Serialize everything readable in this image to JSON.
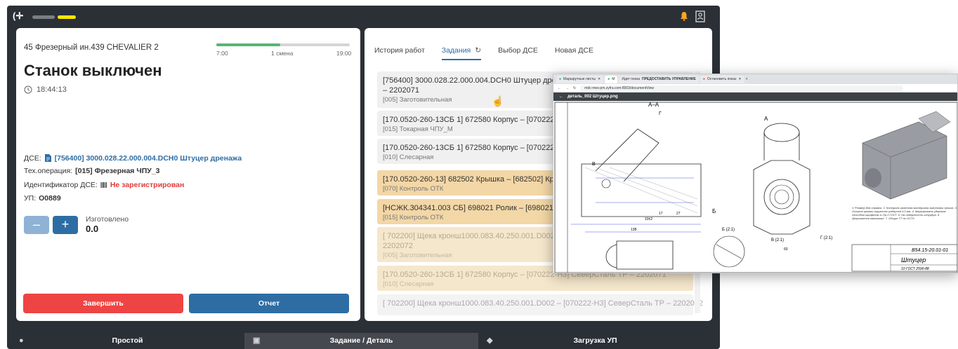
{
  "topbar": {
    "logo": "(✛",
    "bell_color": "#f5a623"
  },
  "machine": {
    "name": "45 Фрезерный ин.439 CHEVALIER 2",
    "shift_start": "7:00",
    "shift_name": "1 смена",
    "shift_end": "19:00",
    "shift_progress": 0.48,
    "status": "Станок выключен",
    "time": "18:44:13"
  },
  "details": {
    "dse_label": "ДСЕ:",
    "dse_value": "[756400] 3000.028.22.000.004.DCH0 Штуцер дренажа",
    "op_label": "Тех.операция:",
    "op_value": "[015] Фрезерная ЧПУ_3",
    "id_label": "Идентификатор ДСЕ:",
    "id_value": "Не зарегистрирован",
    "up_label": "УП:",
    "up_value": "O0889"
  },
  "counter": {
    "minus": "–",
    "plus": "+",
    "label": "Изготовлено",
    "value": "0.0"
  },
  "actions": {
    "finish": "Завершить",
    "report": "Отчет"
  },
  "tabs": [
    {
      "label": "История работ"
    },
    {
      "label": "Задания"
    },
    {
      "label": "Выбор ДСЕ"
    },
    {
      "label": "Новая ДСЕ"
    }
  ],
  "tasks": [
    {
      "title": "[756400] 3000.028.22.000.004.DCH0 Штуцер дренажа – [070222-Н3] СеверСталь ТР – 2202071",
      "op": "[005] Заготовительная"
    },
    {
      "title": "[170.0520-260-13СБ 1] 672580 Корпус – [070222-Н3] СеверСталь ТР – 2202071",
      "op": "[015] Токарная ЧПУ_М"
    },
    {
      "title": "[170.0520-260-13СБ 1] 672580 Корпус – [070222-Н3] СеверСталь ТР – 2202071",
      "op": "[010] Слесарная"
    },
    {
      "title": "[170.0520-260-13] 682502 Крышка – [682502] Крышка – 2202071",
      "op": "[070] Контроль ОТК"
    },
    {
      "title": "[НСЖК.304341.003 СБ] 698021 Ролик – [698021] Ролик – 2202071",
      "op": "[015] Контроль ОТК"
    },
    {
      "title": "[ 702200] Щека кронш1000.083.40.250.001.D002 – [070222-Н3] СеверСталь ТР – 2202072",
      "op": "[005] Заготовительная"
    },
    {
      "title": "[170.0520-260-13СБ 1] 672580 Корпус – [070222-Н3] СеверСталь ТР – 2202071",
      "op": "[010] Слесарная"
    },
    {
      "title": "[ 702200] Щека кронш1000.083.40.250.001.D002 – [070222-Н3] СеверСталь ТР – 2202072",
      "op": ""
    }
  ],
  "bottom_nav": [
    {
      "label": "Простой",
      "icon": "clock-icon"
    },
    {
      "label": "Задание / Деталь",
      "icon": "briefcase-icon"
    },
    {
      "label": "Загрузка УП",
      "icon": "box-icon"
    }
  ],
  "browser": {
    "tab1": "Маршрутные листы",
    "tab2": "М",
    "tab3": "Идет показ",
    "tab3b": "ПРЕДОСТАВИТЬ УПРАВЛЕНИЕ",
    "tab4": "Остановить показ",
    "url": "mdc-mes-pm.zyfra.com:8003/documentView",
    "title": "деталь_002 Штуцер.png"
  },
  "drawing": {
    "section_aa": "А–А",
    "section_b": "Б",
    "view_b": "Б (2:1)",
    "view_v": "В (2:1)",
    "view_g": "Г (2:1)",
    "label_a": "А",
    "label_g": "Г",
    "label_v": "В",
    "dim_138": "138",
    "dim_60": "60",
    "dim_17": "17",
    "dim_10": "10±2",
    "dim_27": "27",
    "notes": "1.*Размер для справок. 2. Контроль качества материала заготовки произв. 3. Острые кромки скруглить радиусом 0,2 мм. 4. Маркировать ударным способом шрифтом 4–Пр.3 ГОСТ. 5. На поверхности штуцера. 6. Допускается материал. 7. Общие ТТ по ОСТ4",
    "stamp_code": "В54.15-20.01-01",
    "stamp_name": "Штуцер",
    "stamp_mat": "10 ГОСТ 2590-88"
  }
}
